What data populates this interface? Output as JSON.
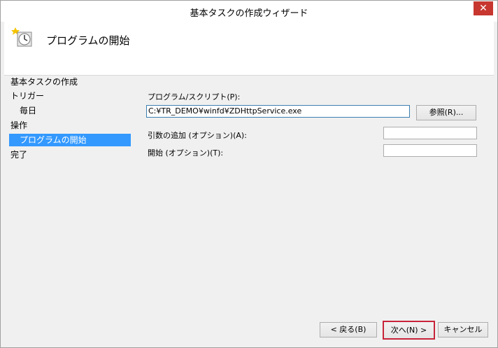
{
  "window": {
    "title": "基本タスクの作成ウィザード",
    "close_label": "✕"
  },
  "header": {
    "title": "プログラムの開始",
    "icon": "clock-icon"
  },
  "nav": {
    "items": [
      {
        "label": "基本タスクの作成"
      },
      {
        "label": "トリガー"
      },
      {
        "label": "毎日"
      },
      {
        "label": "操作"
      },
      {
        "label": "プログラムの開始"
      },
      {
        "label": "完了"
      }
    ]
  },
  "form": {
    "program_label": "プログラム/スクリプト(P):",
    "program_value": "C:¥TR_DEMO¥winfd¥ZDHttpService.exe",
    "browse_label": "参照(R)...",
    "args_label": "引数の追加 (オプション)(A):",
    "args_value": "",
    "start_label": "開始 (オプション)(T):",
    "start_value": ""
  },
  "footer": {
    "back_label": "< 戻る(B)",
    "next_label": "次へ(N) >",
    "cancel_label": "キャンセル"
  }
}
